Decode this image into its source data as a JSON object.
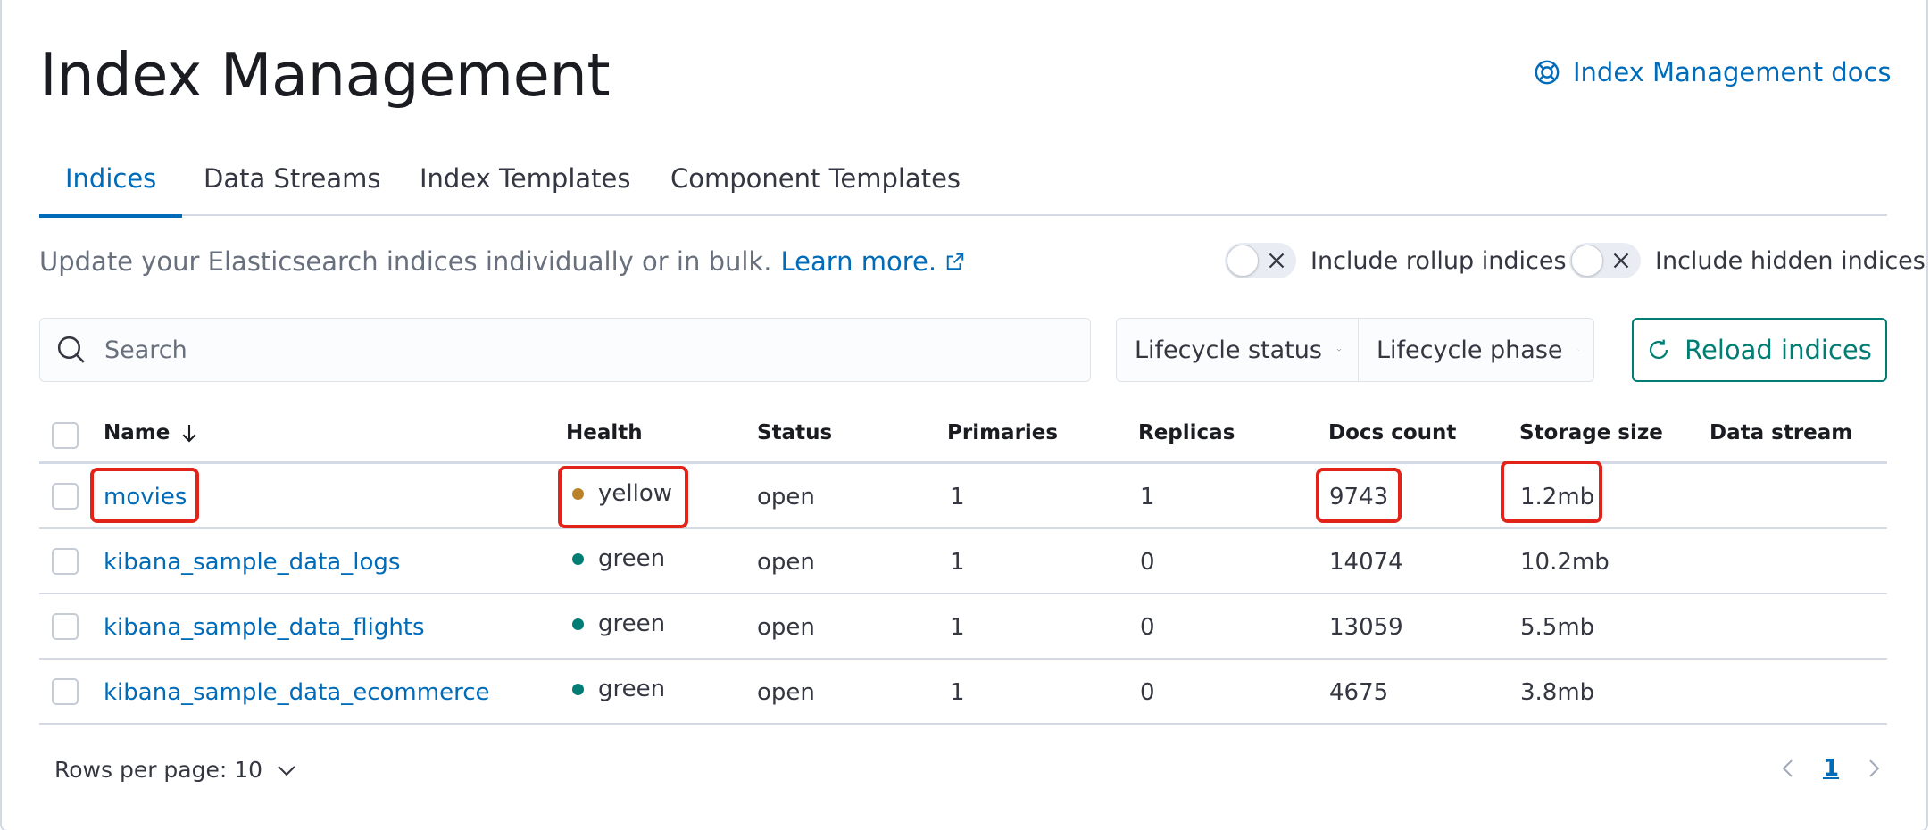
{
  "header": {
    "title": "Index Management",
    "docs_link": "Index Management docs",
    "docs_icon": "help-lifebuoy-icon"
  },
  "tabs": [
    {
      "label": "Indices",
      "active": true
    },
    {
      "label": "Data Streams",
      "active": false
    },
    {
      "label": "Index Templates",
      "active": false
    },
    {
      "label": "Component Templates",
      "active": false
    }
  ],
  "description": {
    "text": "Update your Elasticsearch indices individually or in bulk.",
    "learn_more": "Learn more."
  },
  "toggles": {
    "rollup": {
      "label": "Include rollup indices",
      "on": false
    },
    "hidden": {
      "label": "Include hidden indices",
      "on": false
    }
  },
  "search": {
    "placeholder": "Search",
    "value": ""
  },
  "filters": {
    "lifecycle_status": "Lifecycle status",
    "lifecycle_phase": "Lifecycle phase"
  },
  "reload_button": "Reload indices",
  "table": {
    "columns": [
      "Name",
      "Health",
      "Status",
      "Primaries",
      "Replicas",
      "Docs count",
      "Storage size",
      "Data stream"
    ],
    "rows": [
      {
        "name": "movies",
        "health": "yellow",
        "health_color": "#b9822a",
        "status": "open",
        "primaries": "1",
        "replicas": "1",
        "docs_count": "9743",
        "storage_size": "1.2mb",
        "data_stream": ""
      },
      {
        "name": "kibana_sample_data_logs",
        "health": "green",
        "health_color": "#017d73",
        "status": "open",
        "primaries": "1",
        "replicas": "0",
        "docs_count": "14074",
        "storage_size": "10.2mb",
        "data_stream": ""
      },
      {
        "name": "kibana_sample_data_flights",
        "health": "green",
        "health_color": "#017d73",
        "status": "open",
        "primaries": "1",
        "replicas": "0",
        "docs_count": "13059",
        "storage_size": "5.5mb",
        "data_stream": ""
      },
      {
        "name": "kibana_sample_data_ecommerce",
        "health": "green",
        "health_color": "#017d73",
        "status": "open",
        "primaries": "1",
        "replicas": "0",
        "docs_count": "4675",
        "storage_size": "3.8mb",
        "data_stream": ""
      }
    ]
  },
  "footer": {
    "rows_per_page": "Rows per page: 10",
    "current_page": "1"
  },
  "colors": {
    "accent": "#006bb8",
    "success": "#017d73",
    "highlight": "#e2231a"
  }
}
